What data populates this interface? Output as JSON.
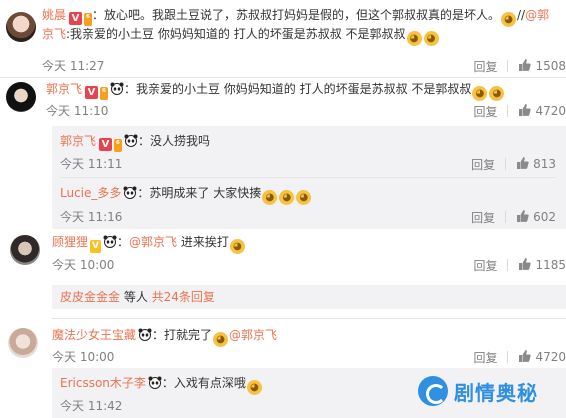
{
  "comments": [
    {
      "name": "姚晨",
      "text": "：放心吧。我跟土豆说了，苏叔叔打妈妈是假的，但这个郭叔叔真的是坏人。",
      "text2": "//",
      "mention": "@郭",
      "line2_mention": "京飞",
      "line2_text": ":我亲爱的小土豆 你妈妈知道的 打人的坏蛋是苏叔叔 不是郭叔叔",
      "time": "今天 11:27",
      "reply": "回复",
      "likes": "1508"
    },
    {
      "name": "郭京飞",
      "text": "：我亲爱的小土豆 你妈妈知道的 打人的坏蛋是苏叔叔 不是郭叔叔",
      "time": "今天 11:10",
      "reply": "回复",
      "likes": "4720"
    },
    {
      "name": "郭京飞",
      "text": "：没人捞我吗",
      "time": "今天 11:11",
      "reply": "回复",
      "likes": "813"
    },
    {
      "name": "Lucie_多多",
      "text": "：苏明成来了 大家快揍",
      "time": "今天 11:16",
      "reply": "回复",
      "likes": "602"
    },
    {
      "name": "顾狸狸",
      "text": "：",
      "mention": "@郭京飞",
      "text_after": " 进来挨打",
      "time": "今天 10:00",
      "reply": "回复",
      "likes": "1185"
    },
    {
      "more_name": "皮皮金金金",
      "more_text": " 等人 ",
      "more_link": "共24条回复"
    },
    {
      "name": "魔法少女王宝藏",
      "text": "：打就完了",
      "mention": "@郭京飞",
      "time": "今天 10:00",
      "reply": "回复",
      "likes": "4720"
    },
    {
      "name": "Ericsson木子李",
      "text": "：入戏有点深哦",
      "time": "今天 11:42"
    }
  ],
  "watermark": "剧情奥秘",
  "icons": {
    "verified_badge": "V",
    "vip_badge": "6",
    "emoji": "smiley-face",
    "panda": "panda-icon",
    "like": "thumb-up-icon"
  }
}
